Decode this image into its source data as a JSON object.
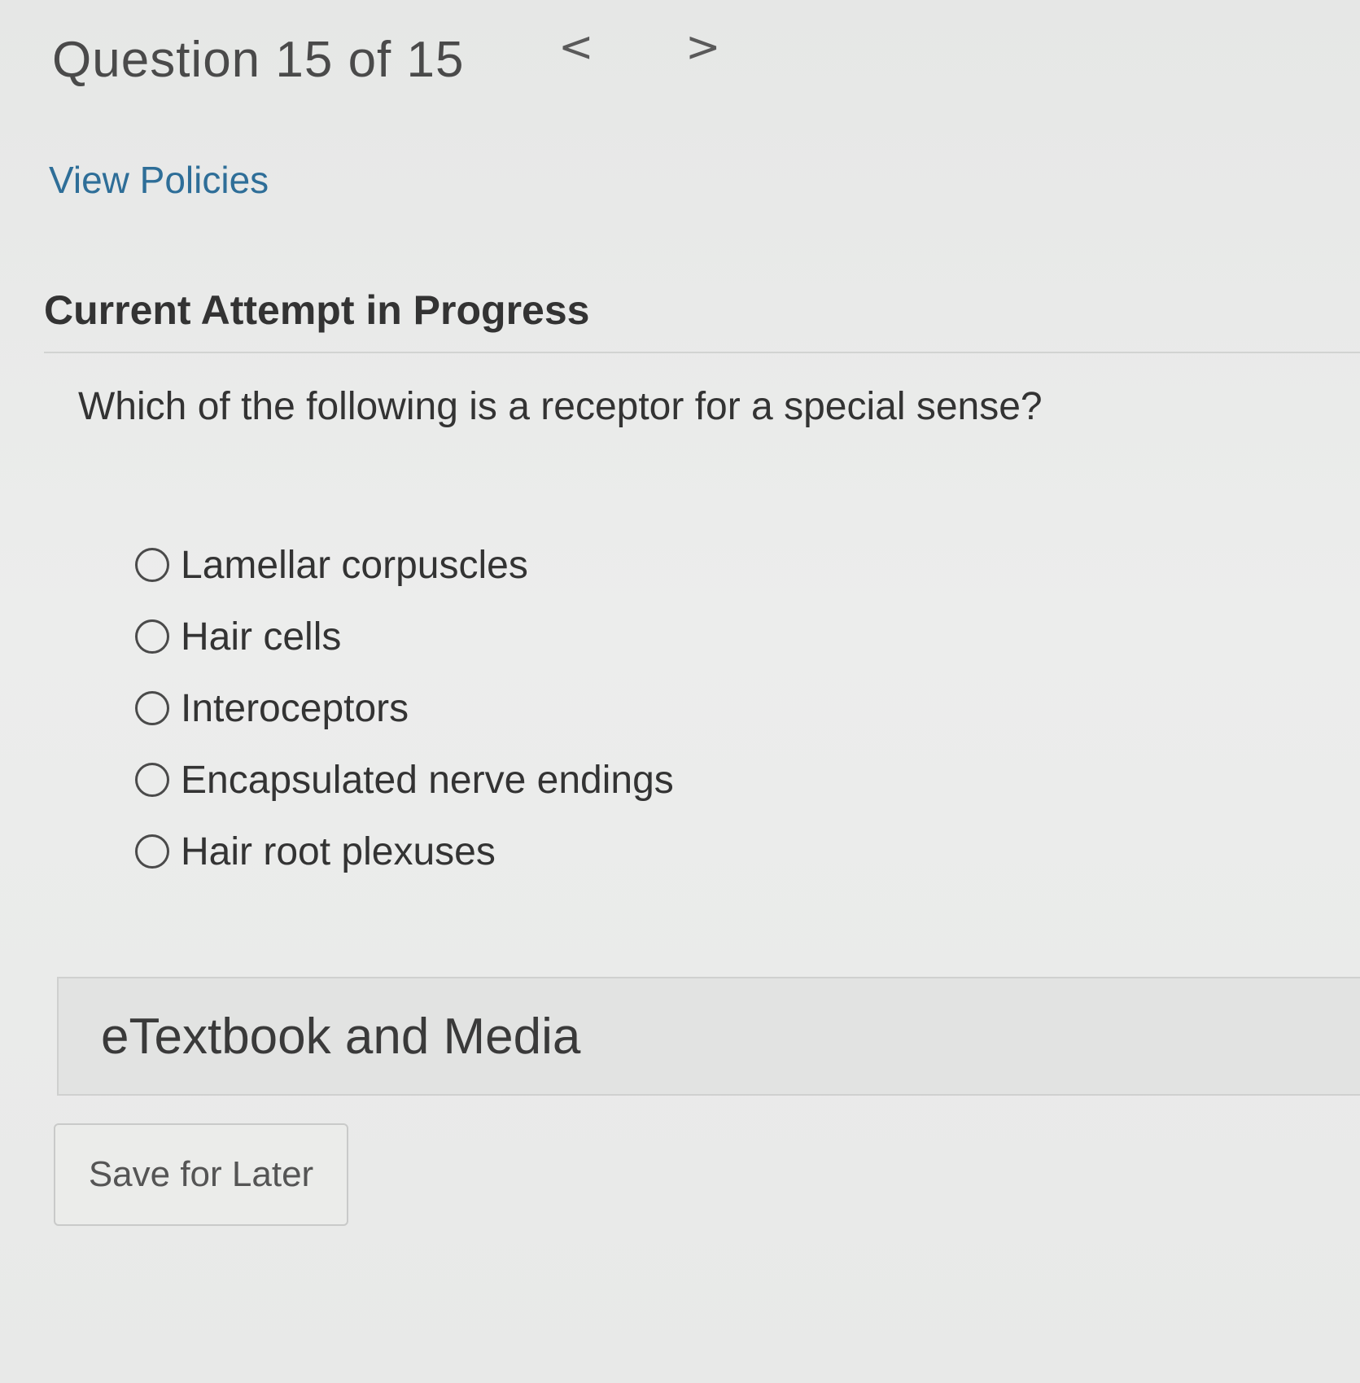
{
  "header": {
    "question_counter": "Question 15 of 15",
    "prev_symbol": "<",
    "next_symbol": ">"
  },
  "links": {
    "view_policies": "View Policies"
  },
  "attempt": {
    "status": "Current Attempt in Progress"
  },
  "question": {
    "prompt": "Which of the following is a receptor for a special sense?",
    "options": [
      {
        "label": "Lamellar corpuscles",
        "selected": false
      },
      {
        "label": "Hair cells",
        "selected": false
      },
      {
        "label": "Interoceptors",
        "selected": false
      },
      {
        "label": "Encapsulated nerve endings",
        "selected": false
      },
      {
        "label": "Hair root plexuses",
        "selected": false
      }
    ]
  },
  "resources": {
    "etextbook_label": "eTextbook and Media"
  },
  "actions": {
    "save_for_later": "Save for Later"
  },
  "colors": {
    "link": "#2e6e98",
    "background": "#e9eae9",
    "text": "#333333"
  }
}
